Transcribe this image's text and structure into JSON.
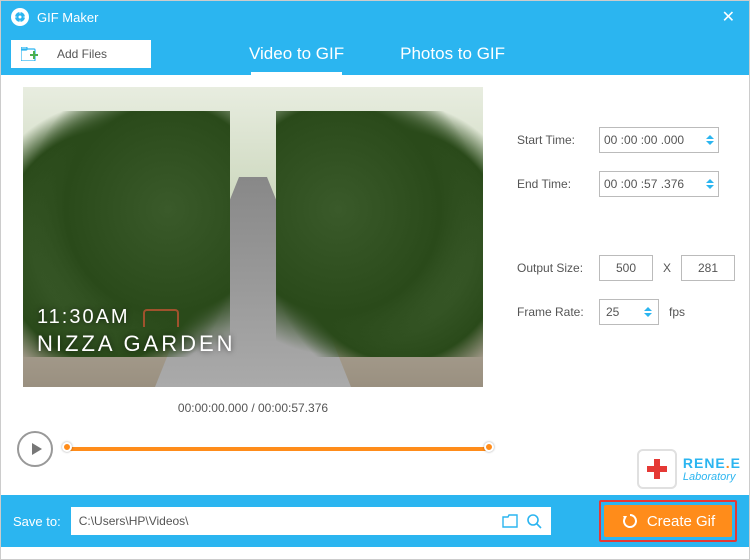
{
  "titlebar": {
    "title": "GIF Maker"
  },
  "toolbar": {
    "add_files": "Add Files"
  },
  "tabs": {
    "video": "Video to GIF",
    "photos": "Photos to GIF"
  },
  "preview": {
    "overlay_time": "11:30AM",
    "overlay_place": "NIZZA GARDEN",
    "time_display": "00:00:00.000 / 00:00:57.376"
  },
  "settings": {
    "start_label": "Start Time:",
    "start_value": "00 :00 :00 .000",
    "end_label": "End Time:",
    "end_value": "00 :00 :57 .376",
    "output_label": "Output Size:",
    "output_w": "500",
    "output_h": "281",
    "fps_label": "Frame Rate:",
    "fps_value": "25",
    "fps_unit": "fps"
  },
  "logo": {
    "line1a": "RENE",
    "dot": ".",
    "line1b": "E",
    "line2": "Laboratory"
  },
  "footer": {
    "save_label": "Save to:",
    "path": "C:\\Users\\HP\\Videos\\",
    "create": "Create Gif"
  }
}
